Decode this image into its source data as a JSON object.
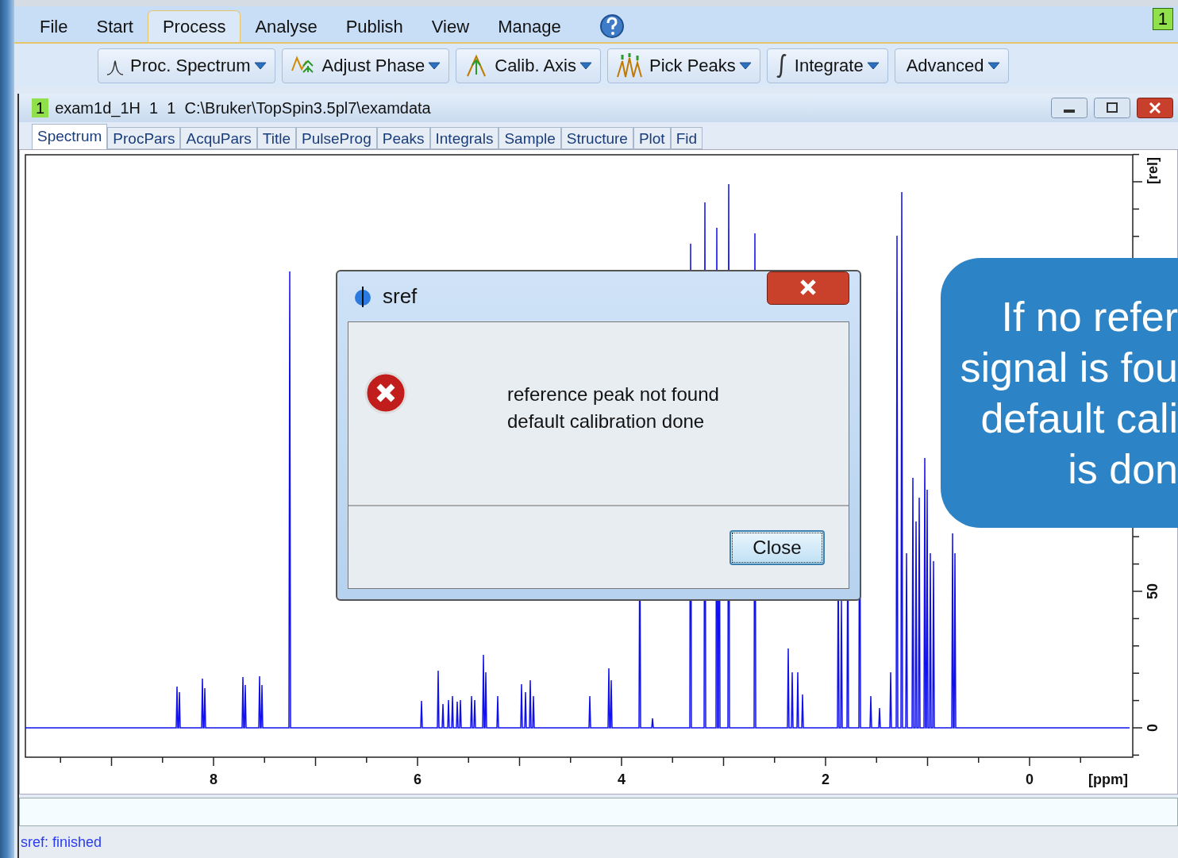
{
  "menu_bar": {
    "items": [
      {
        "label": "File",
        "selected": false
      },
      {
        "label": "Start",
        "selected": false
      },
      {
        "label": "Process",
        "selected": true
      },
      {
        "label": "Analyse",
        "selected": false
      },
      {
        "label": "Publish",
        "selected": false
      },
      {
        "label": "View",
        "selected": false
      },
      {
        "label": "Manage",
        "selected": false
      }
    ],
    "window_number": "1"
  },
  "toolbar": {
    "buttons": [
      {
        "label": "Proc. Spectrum"
      },
      {
        "label": "Adjust Phase"
      },
      {
        "label": "Calib. Axis"
      },
      {
        "label": "Pick Peaks"
      },
      {
        "label": "Integrate"
      },
      {
        "label": "Advanced"
      }
    ]
  },
  "document": {
    "number": "1",
    "title": "exam1d_1H  1  1  C:\\Bruker\\TopSpin3.5pl7\\examdata",
    "tabs": [
      {
        "label": "Spectrum",
        "selected": true
      },
      {
        "label": "ProcPars",
        "selected": false
      },
      {
        "label": "AcquPars",
        "selected": false
      },
      {
        "label": "Title",
        "selected": false
      },
      {
        "label": "PulseProg",
        "selected": false
      },
      {
        "label": "Peaks",
        "selected": false
      },
      {
        "label": "Integrals",
        "selected": false
      },
      {
        "label": "Sample",
        "selected": false
      },
      {
        "label": "Structure",
        "selected": false
      },
      {
        "label": "Plot",
        "selected": false
      },
      {
        "label": "Fid",
        "selected": false
      }
    ]
  },
  "spectrum": {
    "x_ticks": [
      "8",
      "6",
      "4",
      "2",
      "0"
    ],
    "x_unit": "[ppm]",
    "y_ticks": [
      "0",
      "50"
    ],
    "y_unit": "[rel]"
  },
  "dialog": {
    "title": "sref",
    "message": [
      "reference peak not found",
      "default calibration done"
    ],
    "button": "Close"
  },
  "callout": {
    "lines": [
      "If no refer",
      "signal is fou",
      "default cali",
      "is don"
    ]
  },
  "status_bar": "sref: finished"
}
